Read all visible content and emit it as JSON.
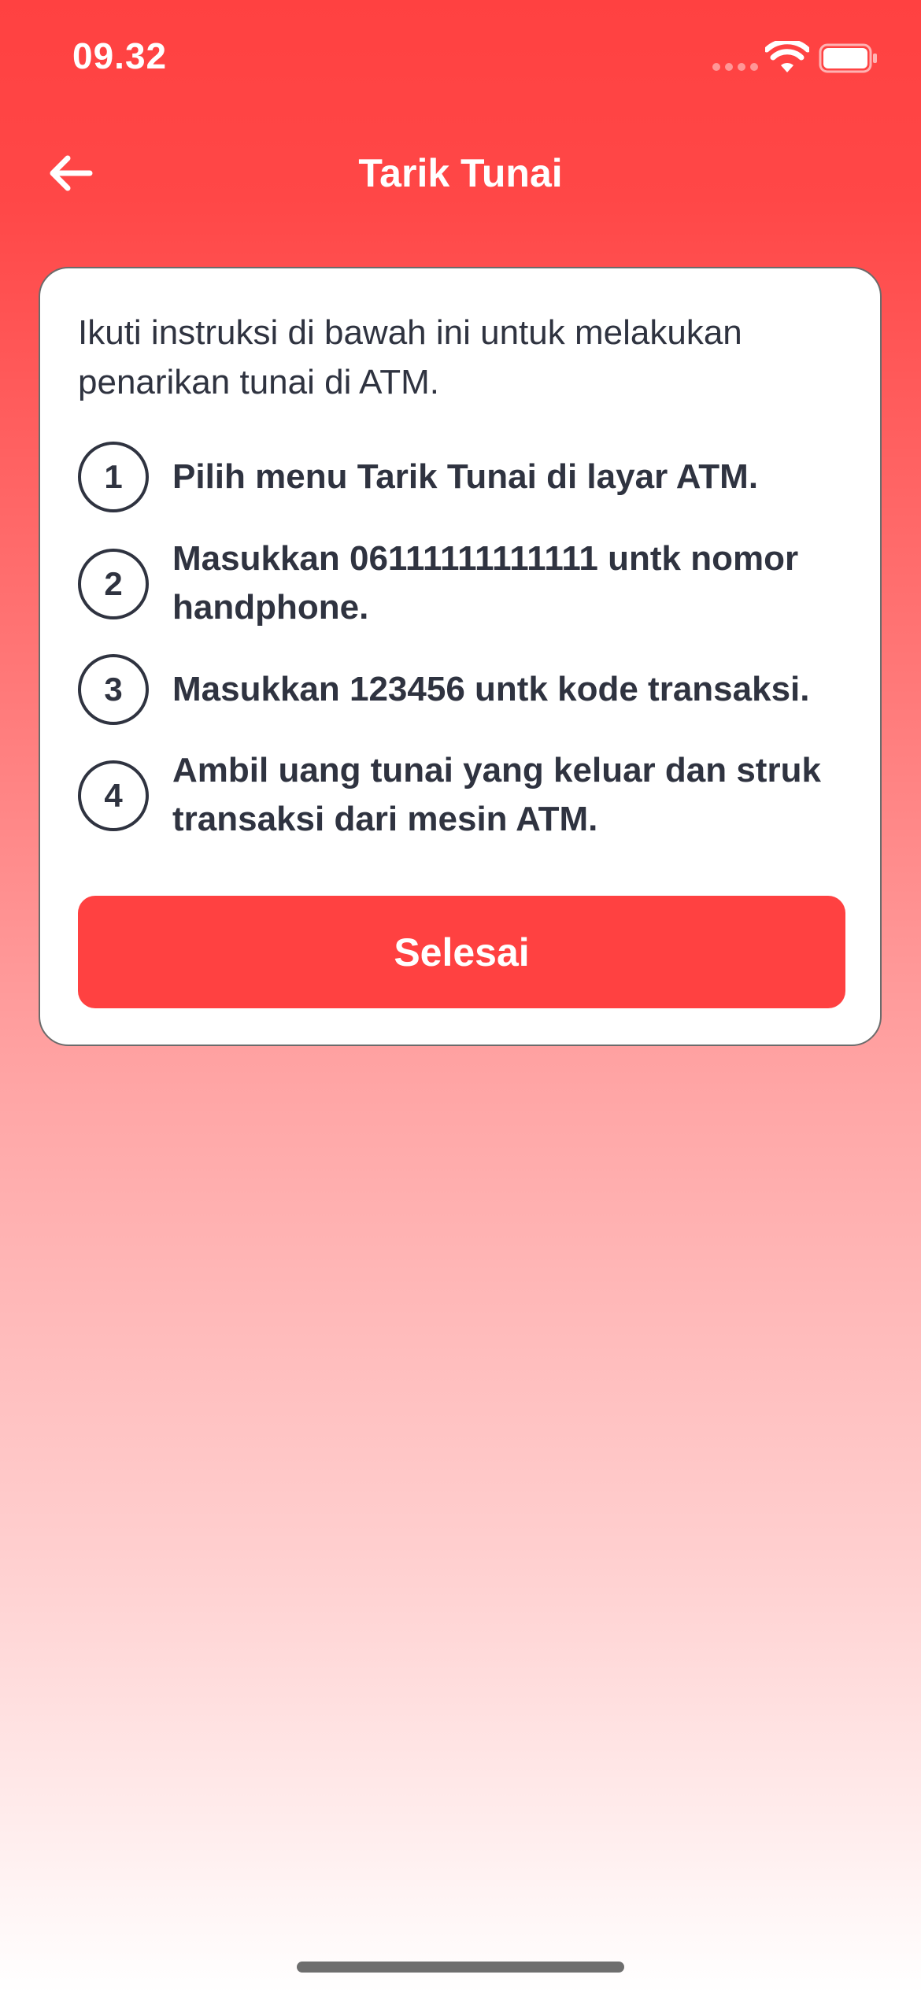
{
  "status_bar": {
    "time": "09.32",
    "wifi_icon": "wifi-icon",
    "battery_icon": "battery-icon"
  },
  "nav": {
    "title": "Tarik Tunai",
    "back_icon": "arrow-left-icon"
  },
  "card": {
    "intro": "Ikuti instruksi di bawah ini untuk melakukan penarikan tunai di ATM.",
    "steps": [
      {
        "number": "1",
        "text": "Pilih menu Tarik Tunai di layar ATM."
      },
      {
        "number": "2",
        "text": "Masukkan 06111111111111 untk nomor handphone."
      },
      {
        "number": "3",
        "text": "Masukkan 123456 untk kode transaksi."
      },
      {
        "number": "4",
        "text": "Ambil uang tunai yang keluar dan struk transaksi dari mesin ATM."
      }
    ],
    "done_label": "Selesai"
  },
  "colors": {
    "primary": "#FF4141",
    "text": "#2F3340",
    "card_bg": "#FFFFFF"
  }
}
